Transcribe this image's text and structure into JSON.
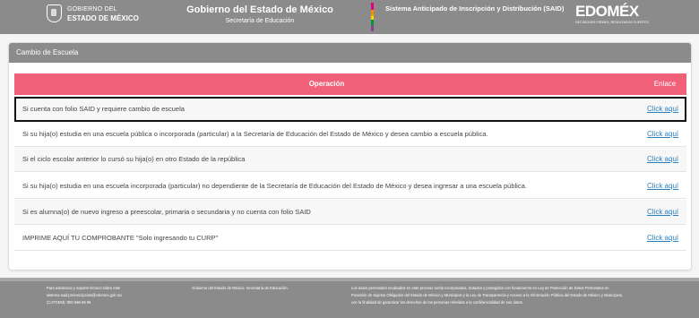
{
  "header": {
    "gob_line1": "GOBIERNO DEL",
    "gob_line2": "ESTADO DE MÉXICO",
    "title": "Gobierno del Estado de México",
    "subtitle": "Secretaría de Educación",
    "system": "Sistema Anticipado de Inscripción y Distribución (SAID)",
    "brand": "EDOMÉX",
    "brand_tagline": "DECISIONES FIRMES, RESULTADOS FUERTES."
  },
  "card": {
    "title": "Cambio de Escuela",
    "columns": {
      "operation": "Operación",
      "link": "Enlace"
    },
    "rows": [
      {
        "text": "Si cuenta con folio SAID y requiere cambio de escuela",
        "link": "Click aquí"
      },
      {
        "text": "Si su hija(o) estudia en una escuela pública o incorporada (particular) a la Secretaría de Educación del Estado de México y desea cambio a escuela pública.",
        "link": "Click aquí"
      },
      {
        "text": "Si el ciclo escolar anterior lo cursó su hija(o) en otro Estado de la república",
        "link": "Click aquí"
      },
      {
        "text": "Si su hija(o) estudia en una escuela incorporada (particular) no dependiente de la Secretaría de Educación del Estado de México y desea ingresar a una escuela pública.",
        "link": "Click aquí"
      },
      {
        "text": "Si es alumna(o) de nuevo ingreso a preescolar, primaria o secundaria y no cuenta con folio SAID",
        "link": "Click aquí"
      },
      {
        "text": "IMPRIME AQUÍ TU COMPROBANTE \"Solo ingresando tu CURP\"",
        "link": "Click aquí"
      }
    ]
  },
  "footer": {
    "support_line1": "Para asistencia y soporte técnico sobre este",
    "support_line2": "sistema said.preinscripcion@edomex.gob.mx",
    "support_line3": "(CATGEM): 800 696 96 96",
    "org": "Gobierno del Estado de México. Secretaría de Educación.",
    "privacy_line1": "Los datos personales recabados en este proceso serán incorporados, tratados y protegidos con fundamento en Ley de Protección de Datos Personales en",
    "privacy_line2": "Posesión de Sujetos Obligados del Estado de México y Municipios y la Ley de Transparencia y Acceso a la Información Pública del Estado de México y Municipios,",
    "privacy_line3": "con la finalidad de garantizar los derechos de las personas referidas a la confidencialidad de sus datos."
  },
  "colors": {
    "header_bg": "#8b8b8c",
    "table_header_bg": "#f06079",
    "link": "#2a7fbf"
  }
}
